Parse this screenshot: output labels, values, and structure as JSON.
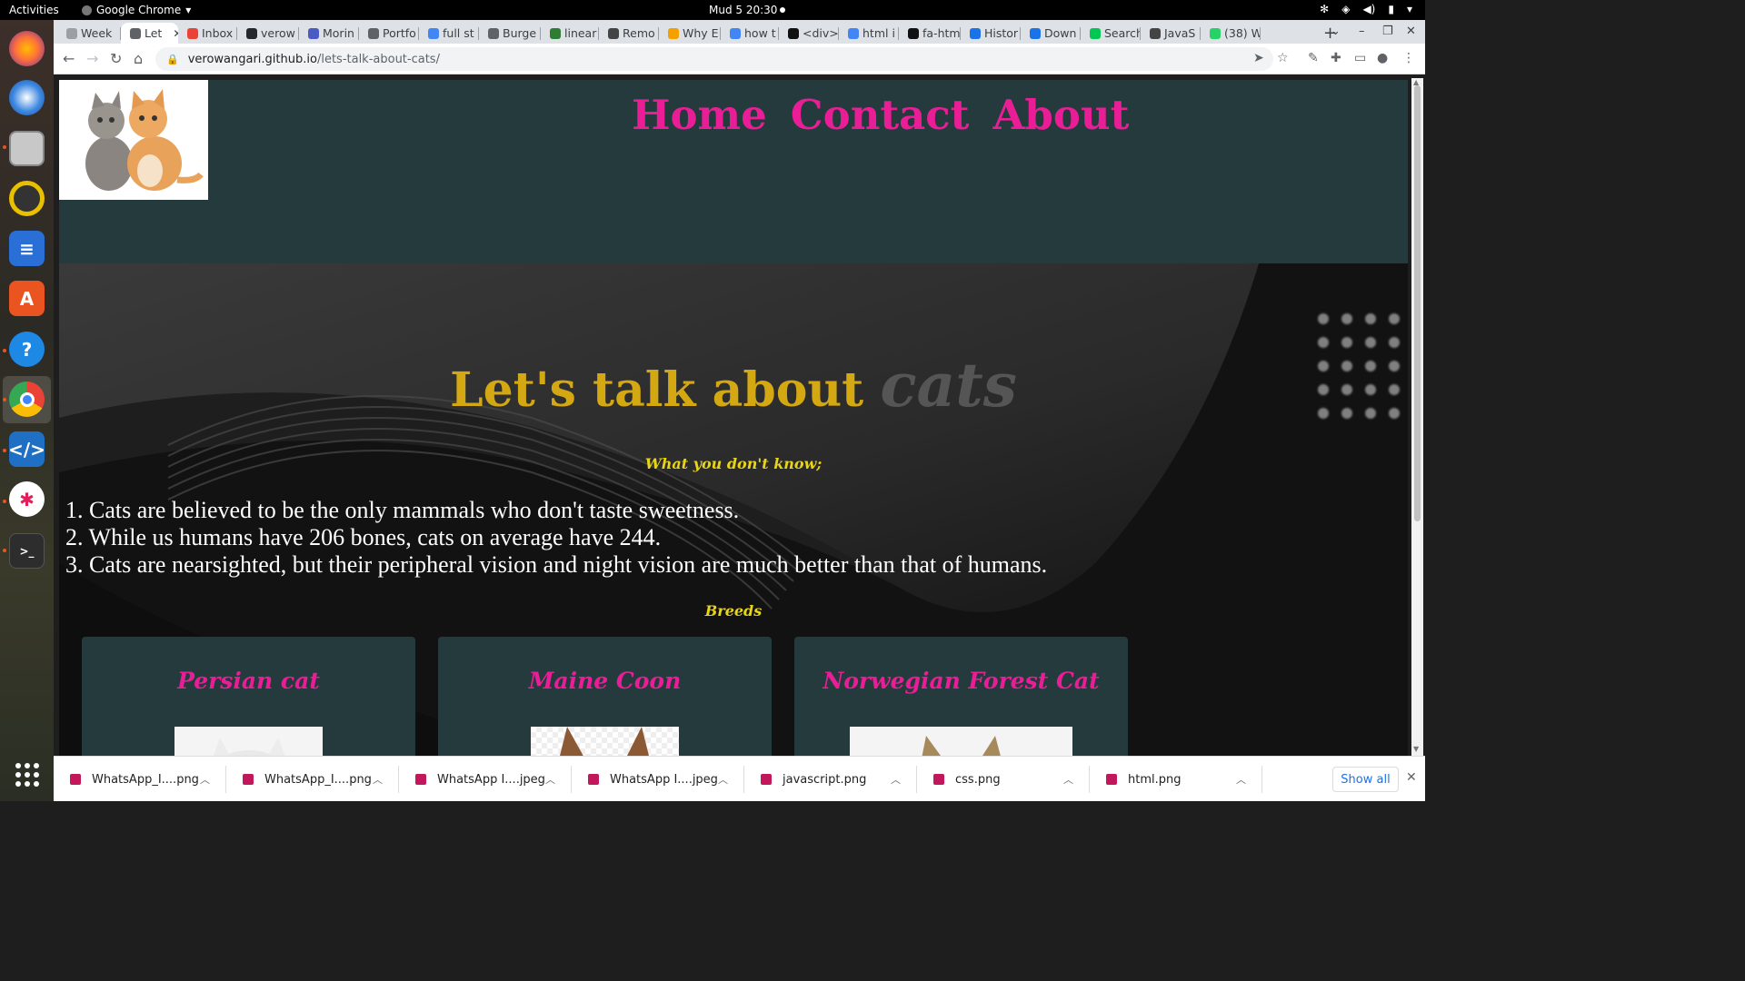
{
  "os": {
    "activities": "Activities",
    "app_name": "Google Chrome",
    "clock": "Mud 5  20:30"
  },
  "tabs": [
    {
      "label": "Week",
      "active": false,
      "color": "#9aa0a6"
    },
    {
      "label": "Let",
      "active": true,
      "color": "#5f6368"
    },
    {
      "label": "Inbox",
      "active": false,
      "color": "#ea4335"
    },
    {
      "label": "verow",
      "active": false,
      "color": "#24292e"
    },
    {
      "label": "Morin",
      "active": false,
      "color": "#4a5bc4"
    },
    {
      "label": "Portfo",
      "active": false,
      "color": "#5f6368"
    },
    {
      "label": "full st",
      "active": false,
      "color": "#4285f4"
    },
    {
      "label": "Burge",
      "active": false,
      "color": "#5f6368"
    },
    {
      "label": "linear",
      "active": false,
      "color": "#2e7d32"
    },
    {
      "label": "Remo",
      "active": false,
      "color": "#444"
    },
    {
      "label": "Why E",
      "active": false,
      "color": "#f4a100"
    },
    {
      "label": "how t",
      "active": false,
      "color": "#4285f4"
    },
    {
      "label": "<div>",
      "active": false,
      "color": "#111"
    },
    {
      "label": "html i",
      "active": false,
      "color": "#4285f4"
    },
    {
      "label": "fa-htm",
      "active": false,
      "color": "#111"
    },
    {
      "label": "Histor",
      "active": false,
      "color": "#1a73e8"
    },
    {
      "label": "Down",
      "active": false,
      "color": "#1a73e8"
    },
    {
      "label": "Search",
      "active": false,
      "color": "#00c853"
    },
    {
      "label": "JavaS",
      "active": false,
      "color": "#444"
    },
    {
      "label": "(38) W",
      "active": false,
      "color": "#25d366"
    }
  ],
  "address": {
    "domain": "verowangari.github.io",
    "path": "/lets-talk-about-cats/"
  },
  "site": {
    "nav": [
      "Home",
      "Contact",
      "About"
    ],
    "title_main": "Let's talk about ",
    "title_accent": "cats",
    "subtitle": "What you don't know;",
    "facts": [
      "1. Cats are believed to be the only mammals who don't taste sweetness.",
      "2. While us humans have 206 bones, cats on average have 244.",
      "3. Cats are nearsighted, but their peripheral vision and night vision are much better than that of humans."
    ],
    "breeds_heading": "Breeds",
    "breeds": [
      "Persian cat",
      "Maine Coon",
      "Norwegian Forest Cat"
    ]
  },
  "downloads": {
    "items": [
      "WhatsApp_I....png",
      "WhatsApp_I....png",
      "WhatsApp I....jpeg",
      "WhatsApp I....jpeg",
      "javascript.png",
      "css.png",
      "html.png"
    ],
    "show_all": "Show all"
  }
}
